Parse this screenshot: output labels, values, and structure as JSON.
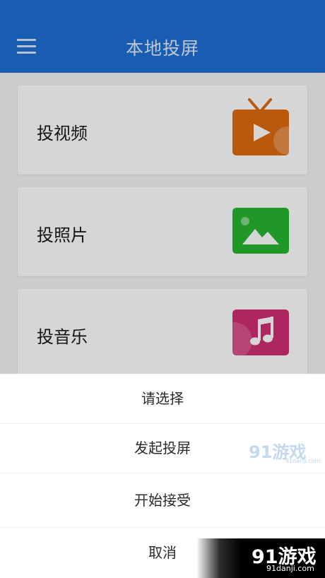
{
  "header": {
    "title": "本地投屏",
    "menu_icon": "hamburger-menu-icon",
    "background_color": "#1e6fd6"
  },
  "cards": [
    {
      "label": "投视频",
      "icon": "tv-video-icon",
      "icon_color": "#dd6a10"
    },
    {
      "label": "投照片",
      "icon": "photo-landscape-icon",
      "icon_color": "#27b52f"
    },
    {
      "label": "投音乐",
      "icon": "music-note-icon",
      "icon_color": "#cf2e72"
    }
  ],
  "sheet": {
    "title": "请选择",
    "options": [
      "发起投屏",
      "开始接受"
    ],
    "cancel": "取消"
  },
  "watermarks": {
    "primary": "91游戏",
    "primary_sub": "91danji.com",
    "secondary": "91游戏",
    "secondary_sub": "91danji.com"
  }
}
